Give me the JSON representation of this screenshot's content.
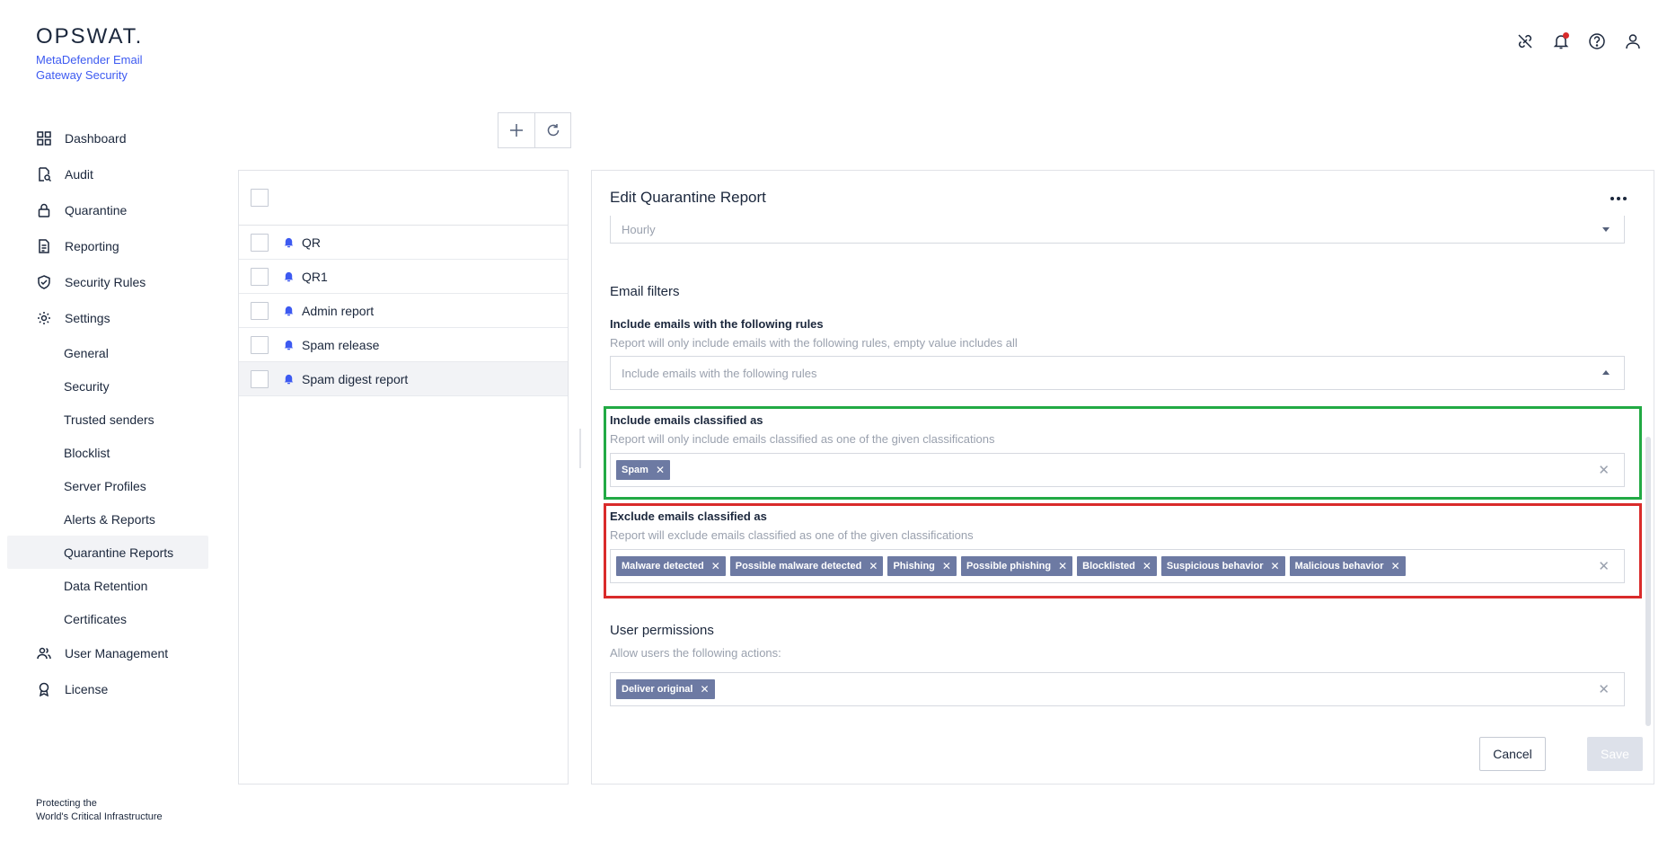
{
  "brand": {
    "logo": "OPSWAT.",
    "product": "MetaDefender Email Gateway Security",
    "tagline_1": "Protecting the",
    "tagline_2": "World's Critical Infrastructure"
  },
  "nav": {
    "dashboard": "Dashboard",
    "audit": "Audit",
    "quarantine": "Quarantine",
    "reporting": "Reporting",
    "security_rules": "Security Rules",
    "settings": "Settings",
    "settings_sub": [
      "General",
      "Security",
      "Trusted senders",
      "Blocklist",
      "Server Profiles",
      "Alerts & Reports",
      "Quarantine Reports",
      "Data Retention",
      "Certificates"
    ],
    "user_management": "User Management",
    "license": "License"
  },
  "reports": [
    "QR",
    "QR1",
    "Admin report",
    "Spam release",
    "Spam digest report"
  ],
  "editor": {
    "title": "Edit Quarantine Report",
    "frequency_value": "Hourly",
    "email_filters_title": "Email filters",
    "include_rules_label": "Include emails with the following rules",
    "include_rules_desc": "Report will only include emails with the following rules, empty value includes all",
    "include_rules_placeholder": "Include emails with the following rules",
    "include_class_label": "Include emails classified as",
    "include_class_desc": "Report will only include emails classified as one of the given classifications",
    "include_class_chips": [
      "Spam"
    ],
    "exclude_class_label": "Exclude emails classified as",
    "exclude_class_desc": "Report will exclude emails classified as one of the given classifications",
    "exclude_class_chips": [
      "Malware detected",
      "Possible malware detected",
      "Phishing",
      "Possible phishing",
      "Blocklisted",
      "Suspicious behavior",
      "Malicious behavior"
    ],
    "permissions_title": "User permissions",
    "permissions_desc": "Allow users the following actions:",
    "permissions_chips": [
      "Deliver original"
    ],
    "cancel": "Cancel",
    "save": "Save"
  },
  "colors": {
    "accent": "#3d5af1",
    "chip": "#6d7aa3",
    "highlight_include": "#22aa44",
    "highlight_exclude": "#d92b2b"
  }
}
